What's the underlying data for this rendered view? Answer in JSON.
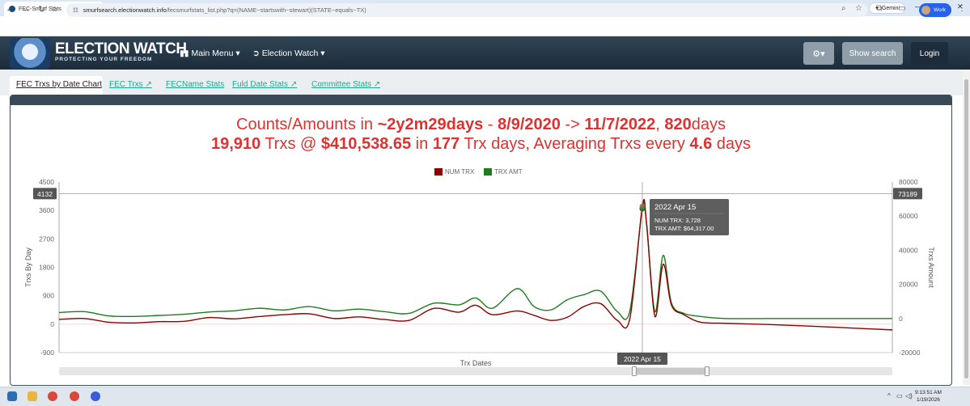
{
  "browser": {
    "tab_title": "FEC-Smurf Stats",
    "new_tab_icon": "plus-icon",
    "gemini_label": "Gemini",
    "url_host": "smurfsearch.electionwatch.info",
    "url_path": "/fecsmurfstats_list.php?q=(NAME~startswith~stewart)(STATE~equals~TX)",
    "profile_label": "Work"
  },
  "site": {
    "logo_title": "ELECTION WATCH",
    "logo_subtitle": "PROTECTING YOUR FREEDOM",
    "menu_main": "Main Menu",
    "menu_election": "Election Watch",
    "show_search": "Show search",
    "login": "Login"
  },
  "tabs": [
    {
      "label": "FEC Trxs by Date Chart",
      "active": true
    },
    {
      "label": "FEC Trxs",
      "active": false
    },
    {
      "label": "FECName Stats",
      "active": false
    },
    {
      "label": "Fuld Date Stats",
      "active": false
    },
    {
      "label": "Committee Stats",
      "active": false
    }
  ],
  "summary": {
    "l1_a": "Counts/Amounts in ",
    "l1_b": "~2y2m29days",
    "l1_c": " - ",
    "l1_d": "8/9/2020",
    "l1_e": " -> ",
    "l1_f": "11/7/2022",
    "l1_g": ", ",
    "l1_h": "820",
    "l1_i": "days",
    "l2_a": "19,910",
    "l2_b": " Trxs @ ",
    "l2_c": "$410,538.65",
    "l2_d": " in ",
    "l2_e": "177",
    "l2_f": " Trx days, Averaging Trxs every ",
    "l2_g": "4.6",
    "l2_h": " days"
  },
  "tooltip": {
    "date": "2022 Apr 15",
    "line1": "NUM TRX: 3,728",
    "line2": "TRX AMT: $64,317.00"
  },
  "crosshair": {
    "left_value": "4132",
    "right_value": "73189",
    "x_label": "2022 Apr 15"
  },
  "taskbar": {
    "time": "9:13:51 AM",
    "date": "1/19/2026"
  },
  "chart_data": {
    "type": "line",
    "xlabel": "Trx Dates",
    "ylabel": "Trxs By Day",
    "y2label": "Trxs Amount",
    "ylim": [
      -900,
      4500
    ],
    "y2lim": [
      -20000,
      80000
    ],
    "yticks": [
      "4500",
      "3600",
      "2700",
      "1800",
      "900",
      "0",
      "-900"
    ],
    "y2ticks": [
      "80000",
      "60000",
      "40000",
      "20000",
      "0",
      "-20000"
    ],
    "legend": "top-center",
    "grid": false,
    "x": [
      0,
      0.03,
      0.06,
      0.09,
      0.12,
      0.15,
      0.18,
      0.21,
      0.24,
      0.27,
      0.3,
      0.33,
      0.36,
      0.39,
      0.42,
      0.45,
      0.48,
      0.5,
      0.52,
      0.55,
      0.57,
      0.59,
      0.61,
      0.63,
      0.65,
      0.67,
      0.685,
      0.7,
      0.705,
      0.715,
      0.725,
      0.735,
      0.75,
      0.77,
      0.8,
      0.85,
      0.9,
      0.95,
      1.0
    ],
    "series": [
      {
        "name": "NUM TRX",
        "color": "#8b0000",
        "axis": "left",
        "values": [
          150,
          180,
          60,
          40,
          80,
          90,
          210,
          170,
          240,
          300,
          330,
          180,
          230,
          150,
          120,
          500,
          380,
          600,
          300,
          420,
          280,
          120,
          220,
          560,
          650,
          120,
          180,
          3728,
          3200,
          250,
          1900,
          600,
          300,
          60,
          30,
          -10,
          -60,
          -120,
          -180
        ]
      },
      {
        "name": "TRX AMT",
        "color": "#1e7b1e",
        "axis": "right",
        "values": [
          3500,
          4000,
          1500,
          1200,
          1800,
          2500,
          3800,
          4500,
          6000,
          5000,
          7000,
          4500,
          5500,
          4000,
          3000,
          9000,
          8000,
          12000,
          6000,
          17500,
          7000,
          5000,
          11000,
          14000,
          16000,
          4000,
          4500,
          64317,
          56000,
          4000,
          37000,
          9000,
          3000,
          1200,
          0,
          0,
          0,
          0,
          0
        ]
      }
    ]
  }
}
